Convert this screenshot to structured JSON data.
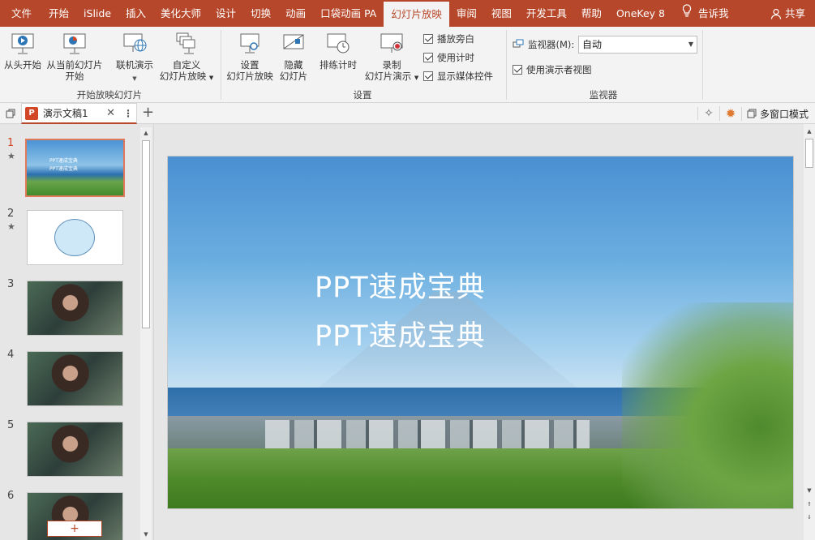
{
  "menubar": {
    "tabs": [
      "文件",
      "开始",
      "iSlide",
      "插入",
      "美化大师",
      "设计",
      "切换",
      "动画",
      "口袋动画 PA",
      "幻灯片放映",
      "审阅",
      "视图",
      "开发工具",
      "帮助",
      "OneKey 8"
    ],
    "active_tab": "幻灯片放映",
    "tell_me": "告诉我",
    "share": "共享"
  },
  "ribbon": {
    "start_group": {
      "label": "开始放映幻灯片",
      "from_beginning": "从头开始",
      "from_current_1": "从当前幻灯片",
      "from_current_2": "开始",
      "online": "联机演示",
      "custom_1": "自定义",
      "custom_2": "幻灯片放映"
    },
    "setup_group": {
      "label": "设置",
      "setup_1": "设置",
      "setup_2": "幻灯片放映",
      "hide_1": "隐藏",
      "hide_2": "幻灯片",
      "rehearse": "排练计时",
      "record_1": "录制",
      "record_2": "幻灯片演示",
      "play_narration": "播放旁白",
      "use_timings": "使用计时",
      "show_media": "显示媒体控件"
    },
    "monitor_group": {
      "label": "监视器",
      "monitor_label": "监视器(M):",
      "monitor_value": "自动",
      "presenter_view": "使用演示者视图"
    }
  },
  "doc": {
    "tab_name": "演示文稿1",
    "multi_window": "多窗口模式"
  },
  "thumbnails": [
    {
      "num": "1",
      "star": "★",
      "text1": "PPT速成宝典",
      "text2": "PPT速成宝典"
    },
    {
      "num": "2",
      "star": "★"
    },
    {
      "num": "3"
    },
    {
      "num": "4"
    },
    {
      "num": "5"
    },
    {
      "num": "6"
    }
  ],
  "slide": {
    "line1": "PPT速成宝典",
    "line2": "PPT速成宝典"
  },
  "colors": {
    "accent": "#b7472a",
    "ribbon_bg": "#f3f3f3",
    "workspace_bg": "#e6e6e6"
  }
}
